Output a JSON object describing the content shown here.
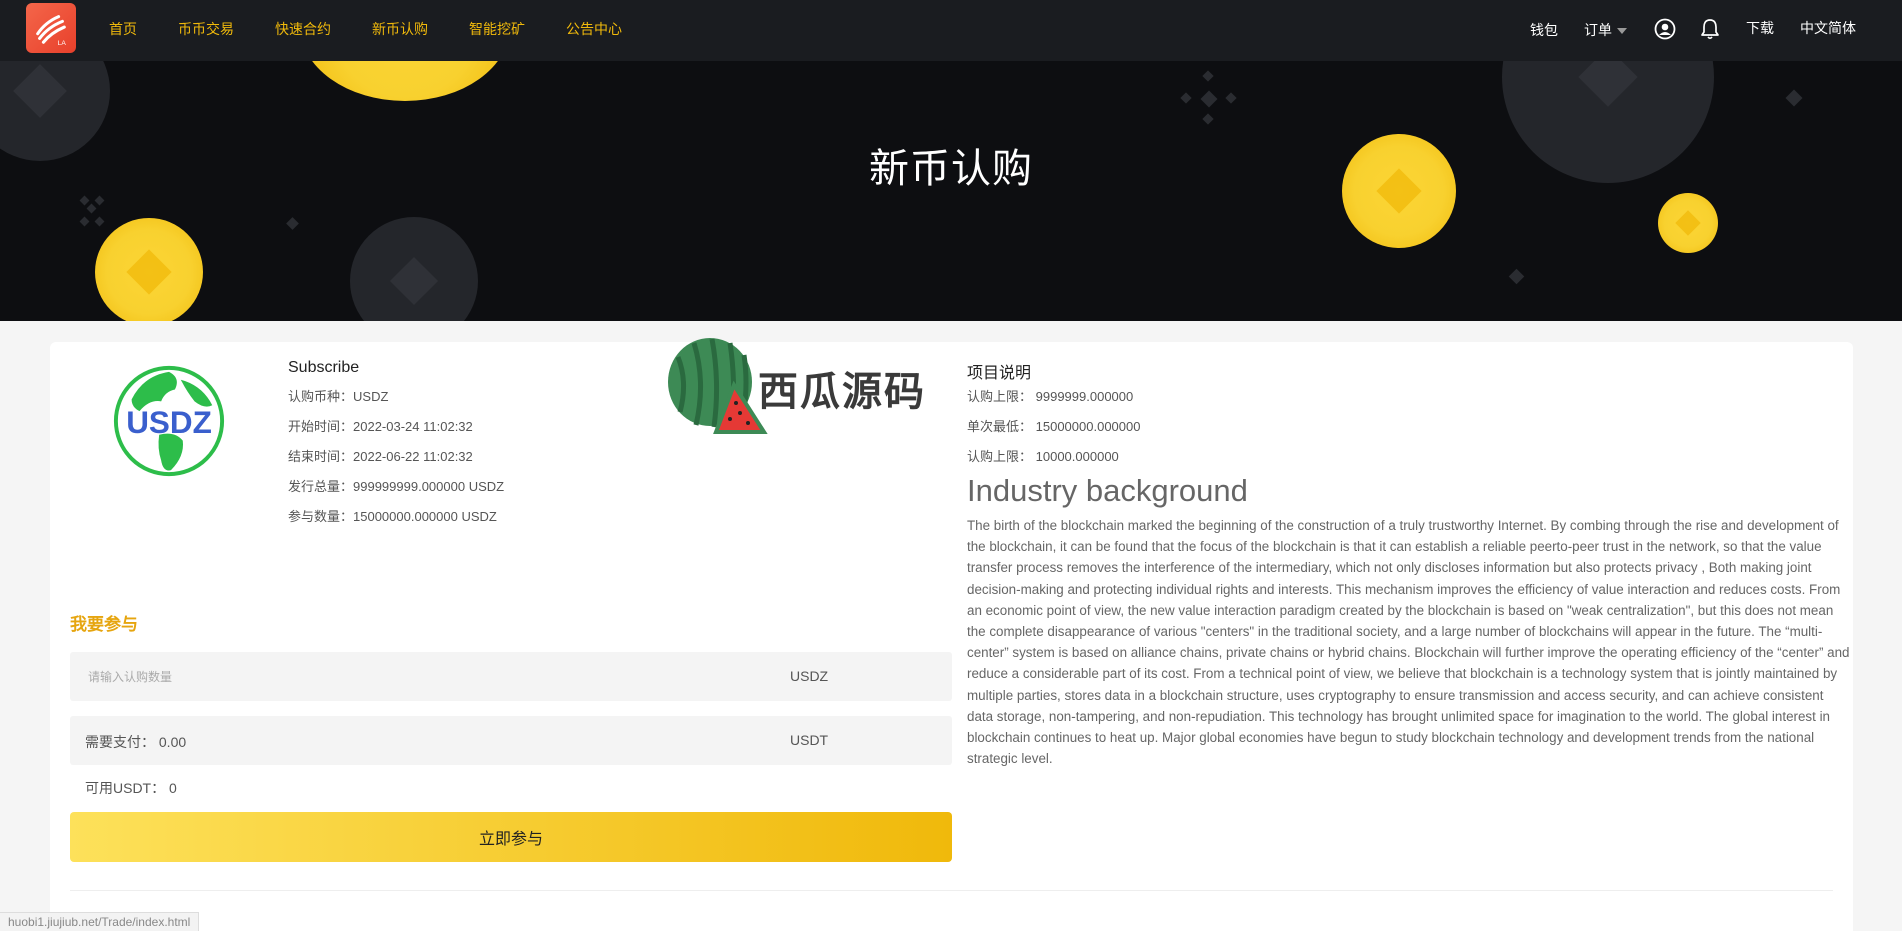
{
  "nav": {
    "links": [
      "首页",
      "币币交易",
      "快速合约",
      "新币认购",
      "智能挖矿",
      "公告中心"
    ],
    "wallet": "钱包",
    "orders": "订单",
    "download": "下载",
    "language": "中文简体",
    "logo_text": "LA"
  },
  "banner": {
    "title": "新币认购"
  },
  "coin": {
    "logo_text": "USDZ",
    "subscribe_title": "Subscribe",
    "info": [
      {
        "label": "认购币种：",
        "value": "USDZ"
      },
      {
        "label": "开始时间：",
        "value": "2022-03-24 11:02:32"
      },
      {
        "label": "结束时间：",
        "value": "2022-06-22 11:02:32"
      },
      {
        "label": "发行总量：",
        "value": "999999999.000000 USDZ"
      },
      {
        "label": "参与数量：",
        "value": "15000000.000000 USDZ"
      }
    ]
  },
  "watermark": {
    "text": "西瓜源码"
  },
  "join": {
    "title": "我要参与",
    "amount_placeholder": "请输入认购数量",
    "amount_unit": "USDZ",
    "pay_label": "需要支付：",
    "pay_value": "0.00",
    "pay_unit": "USDT",
    "available_label": "可用USDT：",
    "available_value": "0",
    "button": "立即参与"
  },
  "project": {
    "title": "项目说明",
    "rows": [
      {
        "label": "认购上限：",
        "value": "9999999.000000"
      },
      {
        "label": "单次最低：",
        "value": "15000000.000000"
      },
      {
        "label": "认购上限：",
        "value": "10000.000000"
      }
    ],
    "industry_title": "Industry background",
    "industry_text": "The birth of the blockchain marked the beginning of the construction of a truly trustworthy Internet. By combing through the rise and development of the blockchain, it can be found that the focus of the blockchain is that it can establish a reliable peerto-peer trust in the network, so that the value transfer process removes the interference of the intermediary, which not only discloses information but also protects privacy , Both making joint decision-making and protecting individual rights and interests. This mechanism improves the efficiency of value interaction and reduces costs. From an economic point of view, the new value interaction paradigm created by the blockchain is based on \"weak centralization\", but this does not mean the complete disappearance of various \"centers\" in the traditional society, and a large number of blockchains will appear in the future. The “multi-center” system is based on alliance chains, private chains or hybrid chains. Blockchain will further improve the operating efficiency of the “center” and reduce a considerable part of its cost. From a technical point of view, we believe that blockchain is a technology system that is jointly maintained by multiple parties, stores data in a blockchain structure, uses cryptography to ensure transmission and access security, and can achieve consistent data storage, non-tampering, and non-repudiation. This technology has brought unlimited space for imagination to the world. The global interest in blockchain continues to heat up. Major global economies have begun to study blockchain technology and development trends from the national strategic level."
  },
  "status_url": "huobi1.jiujiub.net/Trade/index.html",
  "colors": {
    "accent": "#f0b90b",
    "nav_bg": "#1a1c20",
    "banner_bg": "#0d0e11"
  }
}
